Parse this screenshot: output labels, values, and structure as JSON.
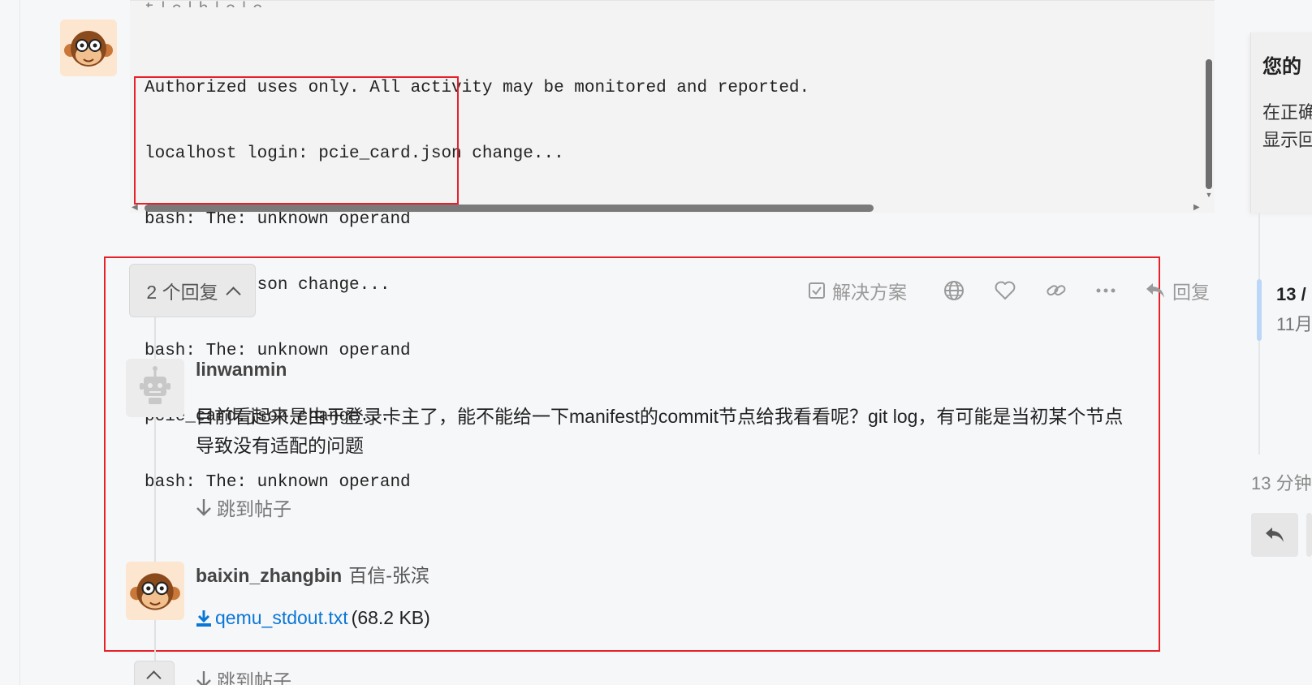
{
  "code_block": {
    "cut_line": "t|c|h|c|c",
    "lines": [
      "Authorized uses only. All activity may be monitored and reported.",
      "localhost login: pcie_card.json change...",
      "bash: The: unknown operand",
      "pcie_card.json change...",
      "bash: The: unknown operand",
      "pcie_card.json change...",
      "bash: The: unknown operand"
    ]
  },
  "replies_toggle": {
    "label": "2 个回复"
  },
  "actions": {
    "solution": "解决方案",
    "reply": "回复"
  },
  "replies": [
    {
      "username": "linwanmin",
      "text": "目前看起来是由于登录卡主了，能不能给一下manifest的commit节点给我看看呢？git log，有可能是当初某个节点导致没有适配的问题",
      "jump": "跳到帖子"
    },
    {
      "username": "baixin_zhangbin",
      "fullname": "百信-张滨",
      "attachment_name": "qemu_stdout.txt",
      "attachment_size": "(68.2 KB)",
      "jump": "跳到帖子"
    }
  ],
  "sidebar": {
    "notice_title": "您的",
    "notice_line1": "在正确",
    "notice_line2": "显示回",
    "timeline_count": "13 /",
    "timeline_date": "11月",
    "timeline_ago": "13 分钟"
  },
  "colors": {
    "highlight_red": "#e8202a",
    "link_blue": "#0a76d6",
    "timeline_handle": "#bcd6f7"
  }
}
